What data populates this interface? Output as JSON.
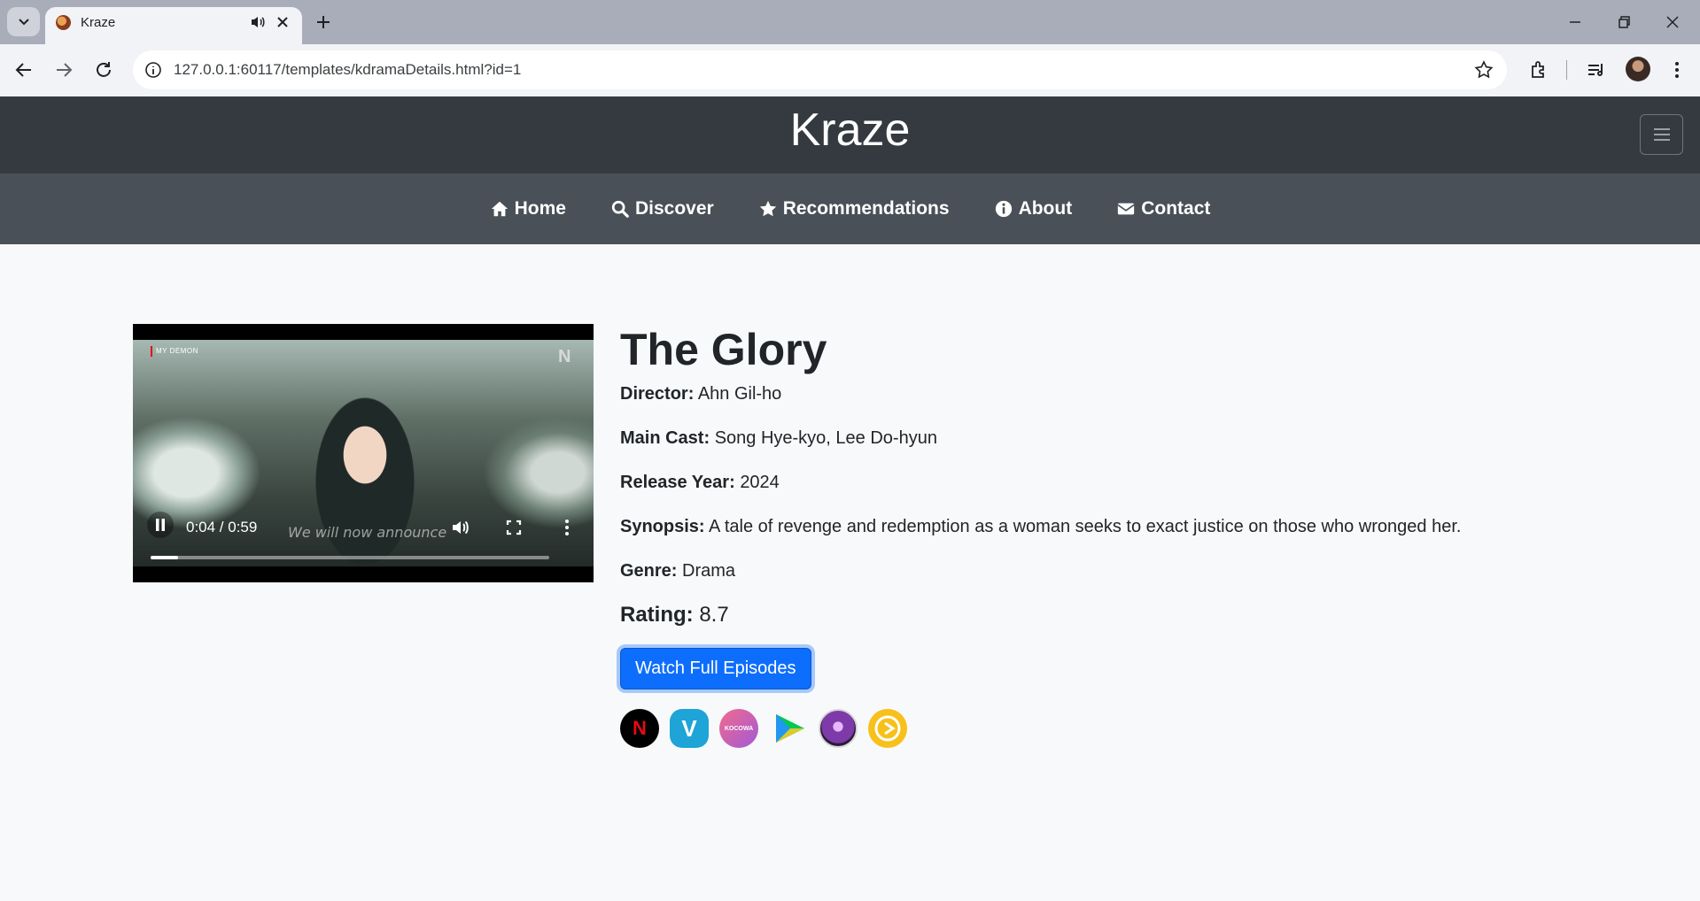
{
  "browser": {
    "tab_title": "Kraze",
    "url": "127.0.0.1:60117/templates/kdramaDetails.html?id=1"
  },
  "site": {
    "brand": "Kraze",
    "nav": [
      {
        "label": "Home",
        "icon": "home-icon"
      },
      {
        "label": "Discover",
        "icon": "search-icon"
      },
      {
        "label": "Recommendations",
        "icon": "star-icon"
      },
      {
        "label": "About",
        "icon": "info-icon"
      },
      {
        "label": "Contact",
        "icon": "envelope-icon"
      }
    ]
  },
  "video": {
    "overlay_label": "MY DEMON",
    "watermark": "N",
    "subtitle": "We will now announce",
    "time": "0:04 / 0:59",
    "progress": 0.068
  },
  "drama": {
    "title": "The Glory",
    "director_label": "Director:",
    "director": "Ahn Gil-ho",
    "cast_label": "Main Cast:",
    "cast": "Song Hye-kyo, Lee Do-hyun",
    "year_label": "Release Year:",
    "year": "2024",
    "synopsis_label": "Synopsis:",
    "synopsis": "A tale of revenge and redemption as a woman seeks to exact justice on those who wronged her.",
    "genre_label": "Genre:",
    "genre": "Drama",
    "rating_label": "Rating:",
    "rating": "8.7",
    "watch_button": "Watch Full Episodes"
  },
  "platforms": [
    {
      "name": "netflix-icon",
      "glyph": "N",
      "bg": "#000000",
      "fg": "#e50914"
    },
    {
      "name": "viki-icon",
      "glyph": "V",
      "bg": "#1ea4d6",
      "fg": "#ffffff"
    },
    {
      "name": "kocowa-icon",
      "glyph": "KOCOWA",
      "bg": "#e0508f",
      "fg": "#ffffff"
    },
    {
      "name": "iqiyi-play-icon",
      "glyph": "",
      "bg": "#ffffff",
      "fg": "#00c853"
    },
    {
      "name": "anime-avatar-icon",
      "glyph": "",
      "bg": "#7e3aa8",
      "fg": "#ffffff"
    },
    {
      "name": "viu-play-icon",
      "glyph": "",
      "bg": "#f7c01a",
      "fg": "#ffffff"
    }
  ]
}
